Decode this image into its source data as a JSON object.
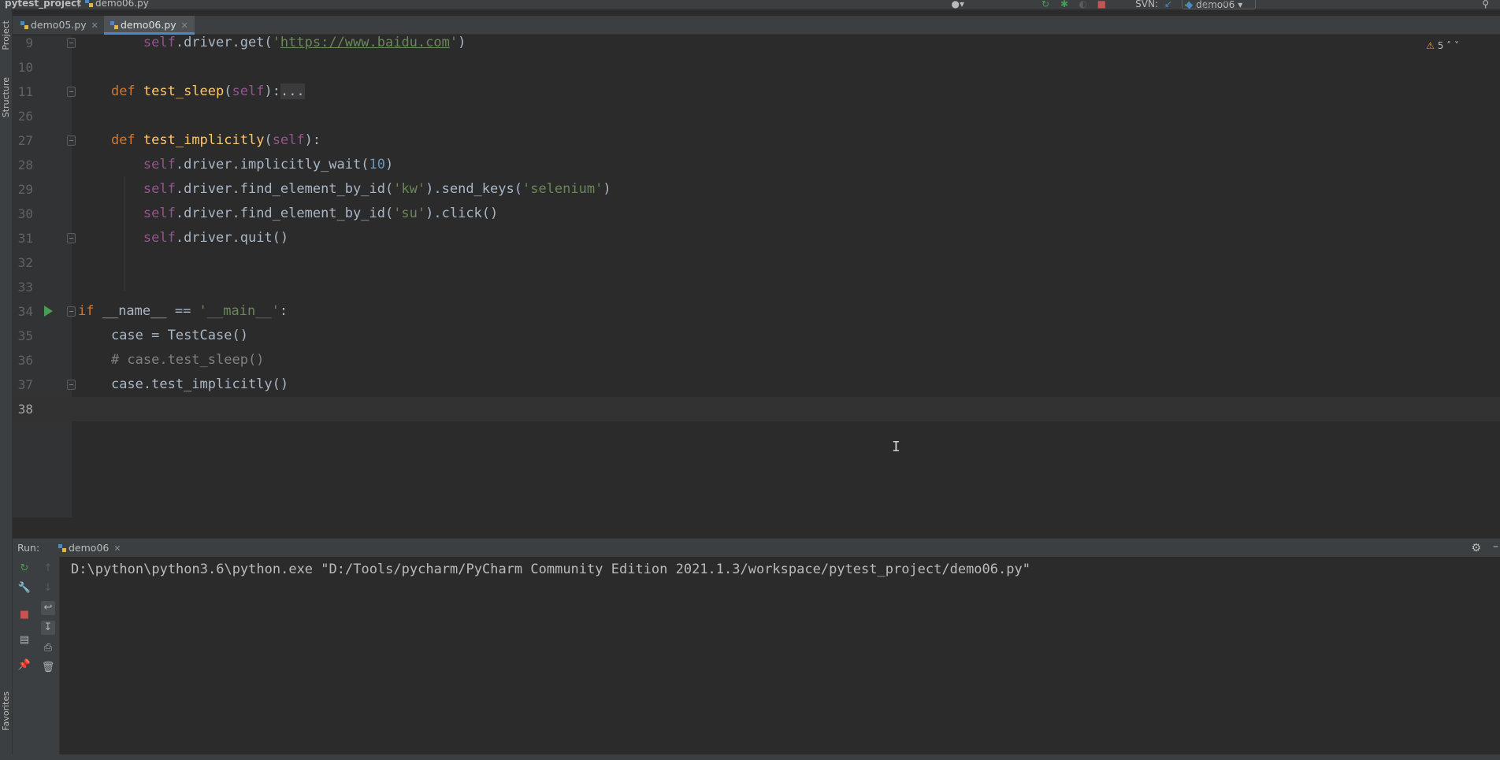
{
  "navbar": {
    "project": "pytest_project",
    "file": "demo06.py",
    "run_config": "demo06",
    "svn_label": "SVN:"
  },
  "left_strip": {
    "project_label": "Project",
    "structure_label": "Structure",
    "favorites_label": "Favorites"
  },
  "tabs": [
    {
      "label": "demo05.py",
      "active": false
    },
    {
      "label": "demo06.py",
      "active": true
    }
  ],
  "editor": {
    "warnings_count": "5",
    "lines": [
      {
        "num": "9"
      },
      {
        "num": "10"
      },
      {
        "num": "11"
      },
      {
        "num": "26"
      },
      {
        "num": "27"
      },
      {
        "num": "28"
      },
      {
        "num": "29"
      },
      {
        "num": "30"
      },
      {
        "num": "31"
      },
      {
        "num": "32"
      },
      {
        "num": "33"
      },
      {
        "num": "34"
      },
      {
        "num": "35"
      },
      {
        "num": "36"
      },
      {
        "num": "37"
      },
      {
        "num": "38"
      }
    ],
    "code": {
      "l9": {
        "self": "self",
        "pre": ".driver.get(",
        "q1": "'",
        "url": "https://www.baidu.com",
        "q2": "'",
        "post": ")"
      },
      "l11": {
        "def": "def ",
        "name": "test_sleep",
        "open": "(",
        "self": "self",
        "close": "):",
        "dots": "..."
      },
      "l27": {
        "def": "def ",
        "name": "test_implicitly",
        "open": "(",
        "self": "self",
        "close": "):"
      },
      "l28": {
        "self": "self",
        "pre": ".driver.implicitly_wait(",
        "num": "10",
        "post": ")"
      },
      "l29": {
        "self": "self",
        "pre": ".driver.find_element_by_id(",
        "s1": "'kw'",
        "mid": ").send_keys(",
        "s2": "'selenium'",
        "post": ")"
      },
      "l30": {
        "self": "self",
        "pre": ".driver.find_element_by_id(",
        "s1": "'su'",
        "post": ").click()"
      },
      "l31": {
        "self": "self",
        "post": ".driver.quit()"
      },
      "l34": {
        "kw": "if",
        "pre": " __name__ == ",
        "str": "'__main__'",
        "post": ":"
      },
      "l35": {
        "text": "case = TestCase()"
      },
      "l36": {
        "comment": "# case.test_sleep()"
      },
      "l37": {
        "text": "case.test_implicitly()"
      }
    }
  },
  "run_panel": {
    "label": "Run:",
    "tab": "demo06",
    "output": "D:\\python\\python3.6\\python.exe \"D:/Tools/pycharm/PyCharm Community Edition 2021.1.3/workspace/pytest_project/demo06.py\""
  },
  "colors": {
    "keyword": "#cc7832",
    "self": "#94558d",
    "function": "#ffc66d",
    "string": "#6a8759",
    "number": "#6897bb",
    "comment": "#808080",
    "run_green": "#499c54",
    "stop_red": "#c75450"
  },
  "icons": [
    "python-file-icon",
    "run-icon",
    "debug-icon",
    "stop-icon",
    "search-icon",
    "gear-icon",
    "warning-icon",
    "rerun-icon",
    "wrench-icon",
    "pin-icon",
    "print-icon",
    "trash-icon",
    "soft-wrap-icon",
    "scroll-to-end-icon",
    "layout-icon",
    "up-arrow-icon",
    "down-arrow-icon",
    "user-icon"
  ]
}
